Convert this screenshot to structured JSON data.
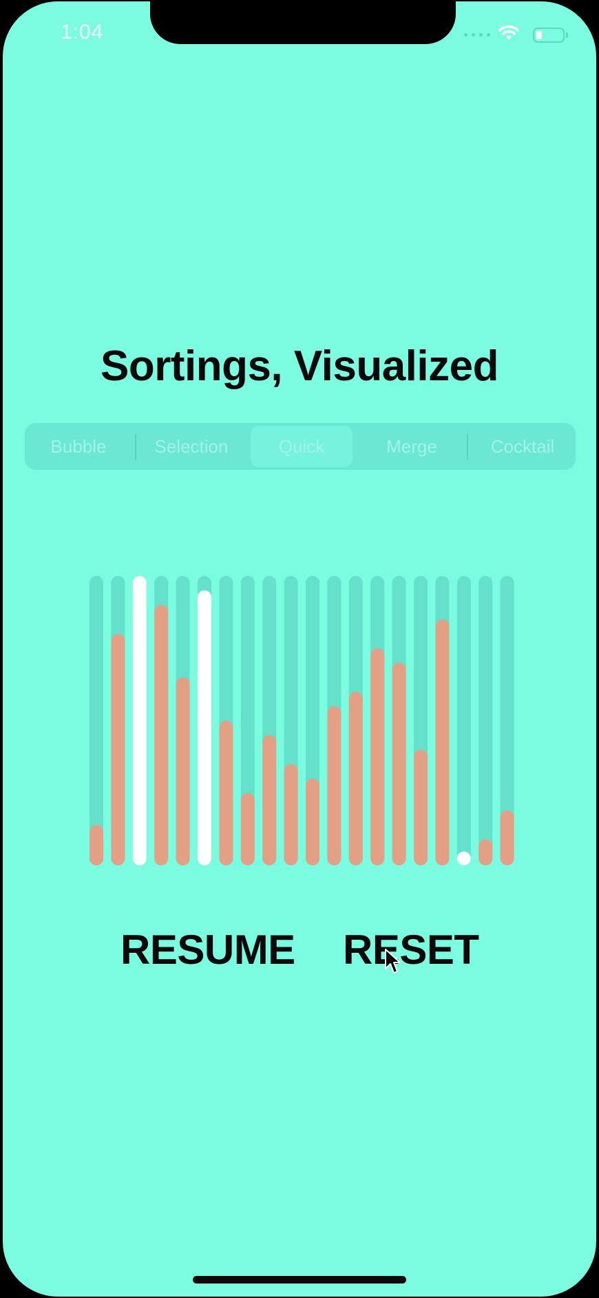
{
  "status_bar": {
    "time": "1:04"
  },
  "title": "Sortings, Visualized",
  "tabs": [
    {
      "label": "Bubble",
      "selected": false
    },
    {
      "label": "Selection",
      "selected": false
    },
    {
      "label": "Quick",
      "selected": true
    },
    {
      "label": "Merge",
      "selected": false
    },
    {
      "label": "Cocktail",
      "selected": false
    }
  ],
  "colors": {
    "background": "#7bfce1",
    "track": "#65e0cb",
    "bar": "#e4a084",
    "highlight": "#ffffff",
    "text": "#0a0a0a"
  },
  "chart_data": {
    "type": "bar",
    "ylim": [
      0,
      100
    ],
    "values": [
      14,
      80,
      100,
      90,
      65,
      95,
      50,
      25,
      45,
      35,
      30,
      55,
      60,
      75,
      70,
      40,
      85,
      2,
      9,
      19
    ],
    "highlighted": [
      2,
      5,
      17
    ]
  },
  "buttons": {
    "resume": "RESUME",
    "reset": "RESET"
  },
  "icons": {
    "cursor": "pointer-cursor-icon",
    "wifi": "wifi-icon",
    "battery": "battery-icon"
  }
}
